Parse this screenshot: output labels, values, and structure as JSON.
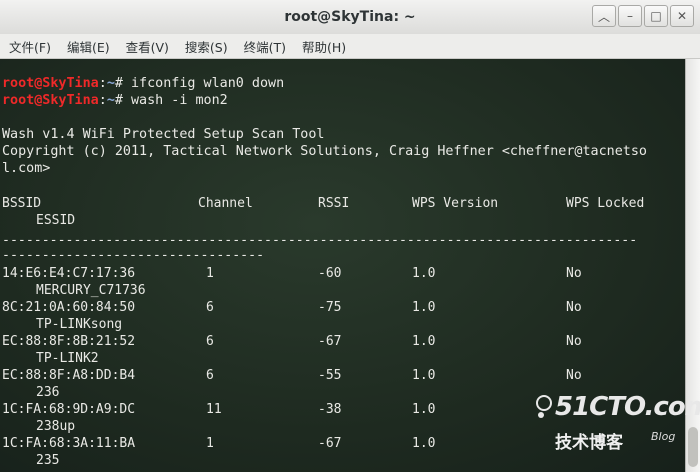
{
  "window": {
    "title": "root@SkyTina: ~"
  },
  "menu": [
    "文件(F)",
    "编辑(E)",
    "查看(V)",
    "搜索(S)",
    "终端(T)",
    "帮助(H)"
  ],
  "prompt": {
    "user": "root@SkyTina",
    "sep": ":",
    "path": "~",
    "symbol": "# "
  },
  "commands": [
    "ifconfig wlan0 down",
    "wash -i mon2"
  ],
  "banner": {
    "line1": "Wash v1.4 WiFi Protected Setup Scan Tool",
    "line2": "Copyright (c) 2011, Tactical Network Solutions, Craig Heffner <cheffner@tacnetso",
    "line3": "l.com>"
  },
  "table": {
    "headers": [
      "BSSID",
      "Channel",
      "RSSI",
      "WPS Version",
      "WPS Locked"
    ],
    "essid_header": "ESSID",
    "separator1": "--------------------------------------------------------------------------------",
    "separator2": "---------------------------------",
    "rows": [
      {
        "bssid": "14:E6:E4:C7:17:36",
        "channel": "1",
        "rssi": "-60",
        "version": "1.0",
        "locked": "No",
        "essid": "MERCURY_C71736"
      },
      {
        "bssid": "8C:21:0A:60:84:50",
        "channel": "6",
        "rssi": "-75",
        "version": "1.0",
        "locked": "No",
        "essid": "TP-LINKsong"
      },
      {
        "bssid": "EC:88:8F:8B:21:52",
        "channel": "6",
        "rssi": "-67",
        "version": "1.0",
        "locked": "No",
        "essid": "TP-LINK2"
      },
      {
        "bssid": "EC:88:8F:A8:DD:B4",
        "channel": "6",
        "rssi": "-55",
        "version": "1.0",
        "locked": "No",
        "essid": "236"
      },
      {
        "bssid": "1C:FA:68:9D:A9:DC",
        "channel": "11",
        "rssi": "-38",
        "version": "1.0",
        "locked": "",
        "essid": "238up"
      },
      {
        "bssid": "1C:FA:68:3A:11:BA",
        "channel": "1",
        "rssi": "-67",
        "version": "1.0",
        "locked": "",
        "essid": "235"
      }
    ]
  },
  "watermark": {
    "main": "51CTO.com",
    "sub": "技术博客",
    "blog": "Blog"
  }
}
